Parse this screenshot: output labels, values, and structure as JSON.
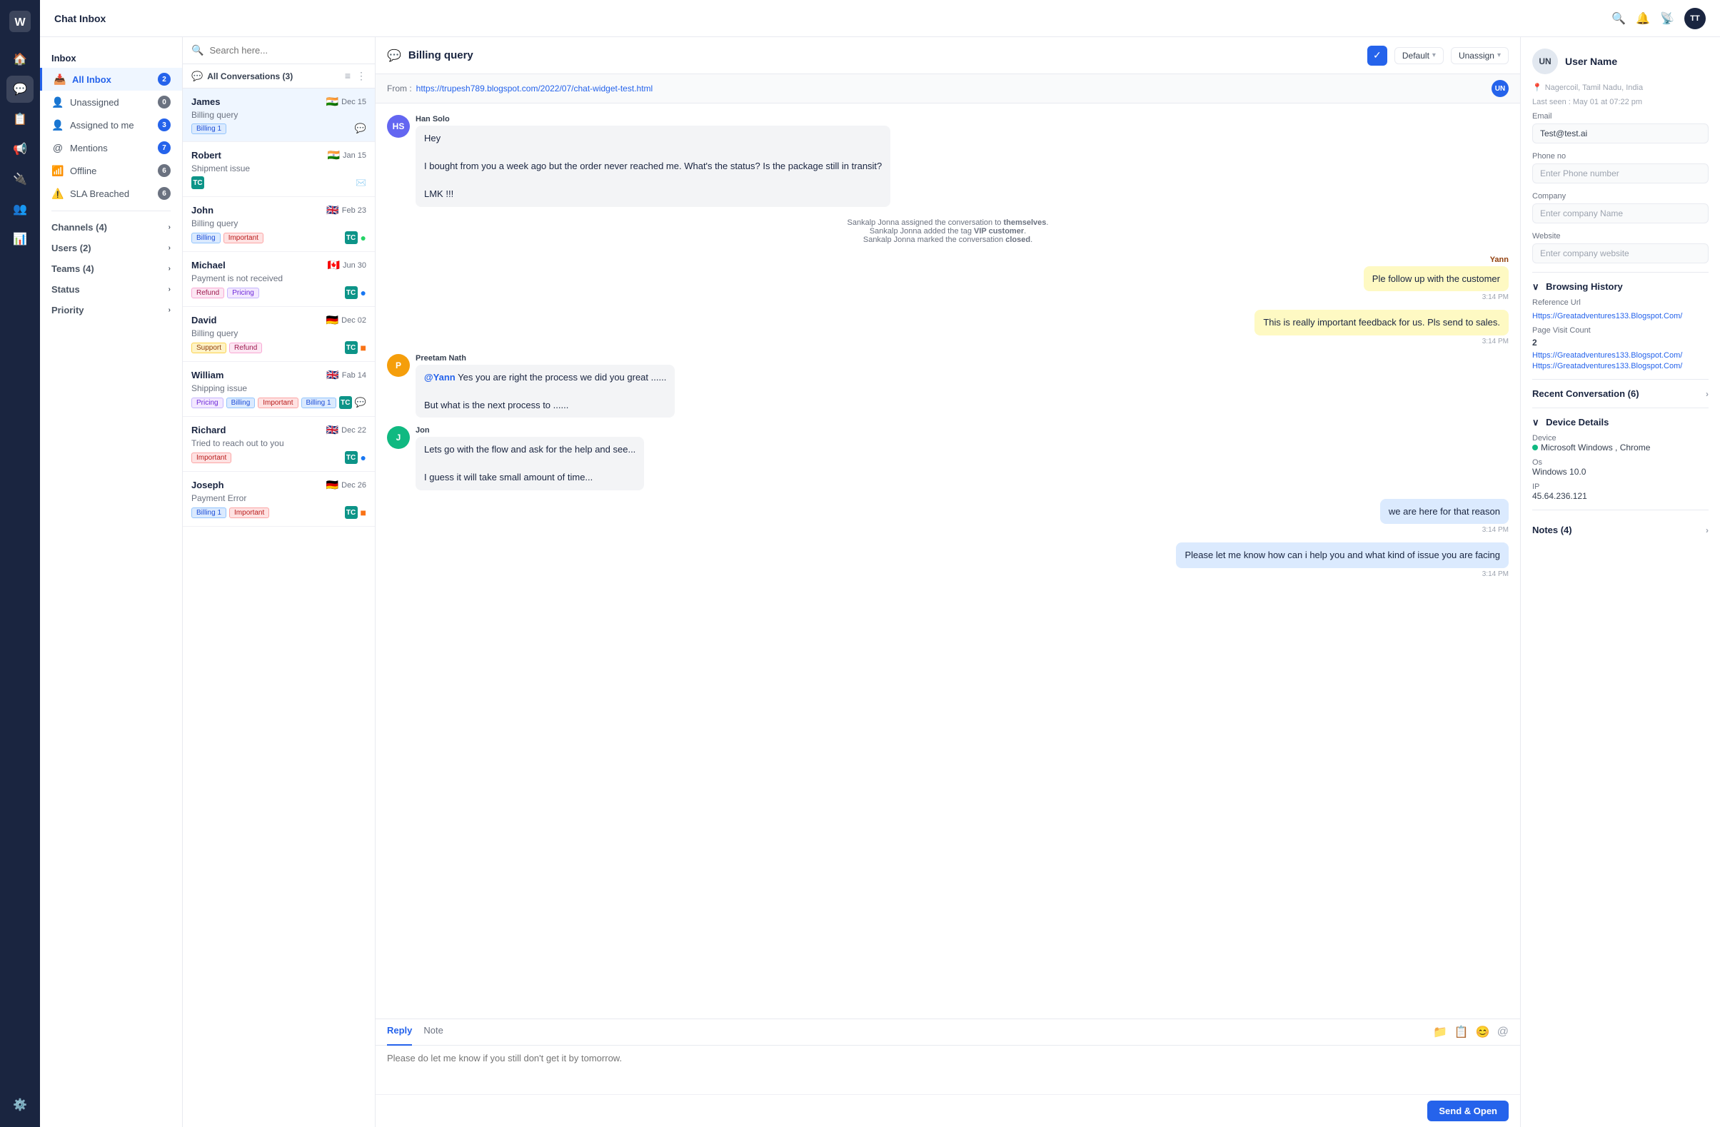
{
  "app": {
    "title": "Chat Inbox"
  },
  "topbar": {
    "title": "Chat Inbox",
    "avatar_initials": "TT"
  },
  "sidebar": {
    "main_section": "Inbox",
    "items": [
      {
        "id": "all-inbox",
        "label": "All Inbox",
        "badge": "2",
        "active": true
      },
      {
        "id": "unassigned",
        "label": "Unassigned",
        "badge": "0"
      },
      {
        "id": "assigned-to-me",
        "label": "Assigned to me",
        "badge": "3"
      },
      {
        "id": "mentions",
        "label": "Mentions",
        "badge": "7"
      },
      {
        "id": "offline",
        "label": "Offline",
        "badge": "6"
      },
      {
        "id": "sla-breached",
        "label": "SLA Breached",
        "badge": "6"
      }
    ],
    "expandables": [
      {
        "id": "channels",
        "label": "Channels (4)"
      },
      {
        "id": "users",
        "label": "Users (2)"
      },
      {
        "id": "teams",
        "label": "Teams (4)"
      },
      {
        "id": "status",
        "label": "Status"
      },
      {
        "id": "priority",
        "label": "Priority"
      }
    ]
  },
  "conv_list": {
    "search_placeholder": "Search here...",
    "header_title": "All Conversations (3)",
    "conversations": [
      {
        "id": "james",
        "name": "James",
        "date": "Dec 15",
        "subject": "Billing query",
        "tags": [
          {
            "label": "Billing 1",
            "type": "billing"
          }
        ],
        "flag": "🇮🇳",
        "indicators": [],
        "has_bubble": true,
        "selected": true
      },
      {
        "id": "robert",
        "name": "Robert",
        "date": "Jan 15",
        "subject": "Shipment issue",
        "tags": [],
        "flag": "🇮🇳",
        "indicators": [
          {
            "label": "TC",
            "type": "teal"
          }
        ],
        "has_email": true,
        "selected": false
      },
      {
        "id": "john",
        "name": "John",
        "date": "Feb 23",
        "subject": "Billing query",
        "tags": [
          {
            "label": "Billing",
            "type": "billing"
          },
          {
            "label": "Important",
            "type": "important"
          }
        ],
        "flag": "🇬🇧",
        "indicators": [
          {
            "label": "TC",
            "type": "teal"
          }
        ],
        "has_wa": true,
        "selected": false
      },
      {
        "id": "michael",
        "name": "Michael",
        "date": "Jun 30",
        "subject": "Payment is not received",
        "tags": [
          {
            "label": "Refund",
            "type": "refund"
          },
          {
            "label": "Pricing",
            "type": "pricing"
          }
        ],
        "flag": "🇨🇦",
        "indicators": [
          {
            "label": "TC",
            "type": "teal"
          }
        ],
        "has_fb": true,
        "selected": false
      },
      {
        "id": "david",
        "name": "David",
        "date": "Dec 02",
        "subject": "Billing query",
        "tags": [
          {
            "label": "Support",
            "type": "support"
          },
          {
            "label": "Refund",
            "type": "refund"
          }
        ],
        "flag": "🇩🇪",
        "indicators": [
          {
            "label": "TC",
            "type": "teal"
          }
        ],
        "selected": false
      },
      {
        "id": "william",
        "name": "William",
        "date": "Fab 14",
        "subject": "Shipping issue",
        "tags": [
          {
            "label": "Pricing",
            "type": "pricing"
          },
          {
            "label": "Billing",
            "type": "billing"
          },
          {
            "label": "Important",
            "type": "important"
          },
          {
            "label": "Billing 1",
            "type": "billing"
          }
        ],
        "flag": "🇬🇧",
        "indicators": [
          {
            "label": "TC",
            "type": "teal"
          }
        ],
        "has_bubble": true,
        "selected": false
      },
      {
        "id": "richard",
        "name": "Richard",
        "date": "Dec 22",
        "subject": "Tried to reach out to you",
        "tags": [
          {
            "label": "Important",
            "type": "important"
          }
        ],
        "flag": "🇬🇧",
        "indicators": [
          {
            "label": "TC",
            "type": "teal"
          }
        ],
        "has_fb": true,
        "selected": false
      },
      {
        "id": "joseph",
        "name": "Joseph",
        "date": "Dec 26",
        "subject": "Payment Error",
        "tags": [
          {
            "label": "Billing 1",
            "type": "billing"
          },
          {
            "label": "Important",
            "type": "important"
          }
        ],
        "flag": "🇩🇪",
        "indicators": [
          {
            "label": "TC",
            "type": "teal"
          }
        ],
        "selected": false
      }
    ]
  },
  "chat": {
    "title": "Billing query",
    "from_label": "From :",
    "from_url": "https://trupesh789.blogspot.com/2022/07/chat-widget-test.html",
    "un_badge": "UN",
    "status_default": "Default",
    "unassign_label": "Unassign",
    "messages": [
      {
        "id": "msg1",
        "type": "incoming",
        "avatar_initials": "HS",
        "avatar_class": "hs",
        "sender": "Han Solo",
        "text": "Hey\n\nI bought from you a week ago but the order never reached me. What's the status? Is the package still in transit?\n\nLMK !!!"
      },
      {
        "id": "sys1",
        "type": "system",
        "text_parts": [
          "Sankalp Jonna assigned the conversation to ",
          "themselves",
          ".",
          "\nSankalp Jonna added the tag ",
          "VIP customer",
          ".",
          "\nSankalp Jonna marked the conversation ",
          "closed",
          "."
        ]
      },
      {
        "id": "msg2",
        "type": "note",
        "sender": "Yann",
        "text": "Ple follow up with the customer",
        "time": "3:14 PM"
      },
      {
        "id": "msg3",
        "type": "note-long",
        "text": "This is really important feedback for us. Pls send to sales.",
        "time": "3:14 PM"
      },
      {
        "id": "msg4",
        "type": "incoming",
        "avatar_initials": "P",
        "avatar_class": "p",
        "sender": "Preetam Nath",
        "text": "@Yann  Yes you are right the process we did you great ......\n\nBut what is the next process to ......"
      },
      {
        "id": "msg5",
        "type": "incoming",
        "avatar_initials": "J",
        "avatar_class": "j",
        "sender": "Jon",
        "text": "Lets go with the flow and ask for the help and see...\n\nI guess it will take small amount of time..."
      },
      {
        "id": "msg6",
        "type": "outgoing",
        "text": "we are here for that reason",
        "time": "3:14 PM"
      },
      {
        "id": "msg7",
        "type": "outgoing",
        "text": "Please let me know how can i help you and what kind of issue you are facing",
        "time": "3:14 PM"
      }
    ],
    "reply_placeholder": "Please do let me know if you still don't get it by tomorrow.",
    "reply_tab": "Reply",
    "note_tab": "Note",
    "send_btn": "Send & Open"
  },
  "right_panel": {
    "contact": {
      "initials": "UN",
      "name": "User Name",
      "location": "Nagercoil, Tamil Nadu, India",
      "last_seen": "Last seen : May 01 at 07:22 pm"
    },
    "email_label": "Email",
    "email_value": "Test@test.ai",
    "phone_label": "Phone no",
    "phone_placeholder": "Enter Phone number",
    "company_label": "Company",
    "company_placeholder": "Enter company Name",
    "website_label": "Website",
    "website_placeholder": "Enter company website",
    "browsing_history": {
      "title": "Browsing History",
      "ref_url_label": "Reference Url",
      "ref_url": "Https://Greatadventures133.Blogspot.Com/",
      "page_visit_label": "Page Visit Count",
      "page_visit_count": "2",
      "history_links": [
        "Https://Greatadventures133.Blogspot.Com/",
        "Https://Greatadventures133.Blogspot.Com/"
      ]
    },
    "recent_conversation": {
      "title": "Recent Conversation (6)"
    },
    "device_details": {
      "title": "Device Details",
      "device_label": "Device",
      "device_value": "Microsoft Windows , Chrome",
      "os_label": "Os",
      "os_value": "Windows 10.0",
      "ip_label": "IP",
      "ip_value": "45.64.236.121"
    },
    "notes": {
      "title": "Notes (4)"
    }
  }
}
